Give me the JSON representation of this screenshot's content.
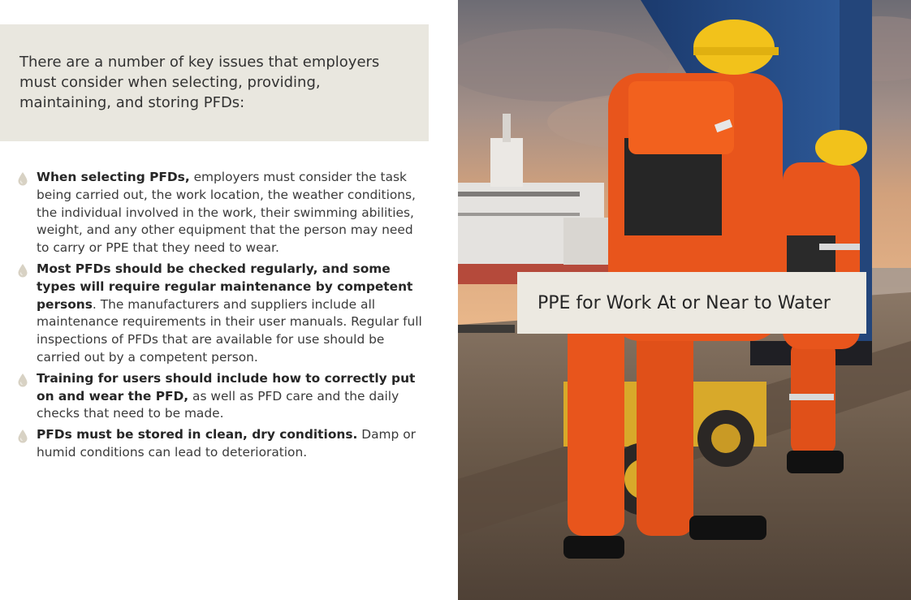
{
  "intro": {
    "text": "There are a number of key issues that employers must consider when selecting, providing, maintaining, and storing PFDs:"
  },
  "bullets": [
    {
      "lead": "When selecting PFDs,",
      "rest": " employers must consider the task being carried out, the work location, the weather conditions, the individual involved in the work, their swimming abilities, weight, and any other equipment that the person may need to carry or PPE that they need to wear."
    },
    {
      "lead": "Most PFDs should be checked regularly, and some types will require regular maintenance by competent persons",
      "rest": ". The manufacturers and suppliers include all maintenance requirements in their user manuals. Regular full inspections of PFDs that are available for use should be carried out by a competent person."
    },
    {
      "lead": "Training for users should include how to correctly put on and wear the PFD,",
      "rest": " as well as PFD care and the daily checks that need to be made."
    },
    {
      "lead": "PFDs must be stored in clean, dry conditions.",
      "rest": " Damp or humid conditions can lead to deterioration."
    }
  ],
  "photo": {
    "caption": "PPE for Work At or Near to Water",
    "icon": "port-workers-photo"
  },
  "colors": {
    "intro_bg": "#e9e7df",
    "caption_bg": "#ece9e1",
    "bullet_drop": "#d8d2c4",
    "workwear_orange": "#e8551c"
  }
}
